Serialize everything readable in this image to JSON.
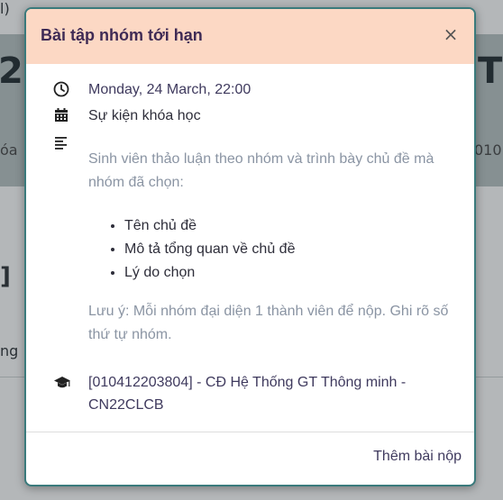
{
  "background": {
    "top_fragment": "l)",
    "big_heading_left": "2(",
    "big_heading_right": "T",
    "small_left": "óa",
    "small_right": "010",
    "bracket_text": "]",
    "lower_left": "ng"
  },
  "modal": {
    "title": "Bài tập nhóm tới hạn",
    "close_label": "×",
    "date": "Monday, 24 March, 22:00",
    "event_type": "Sự kiện khóa học",
    "description_intro": "Sinh viên thảo luận theo nhóm và  trình bày chủ đề mà nhóm đã chọn:",
    "bullets": [
      "Tên chủ đề",
      "Mô tả tổng quan về chủ đề",
      "Lý do chọn"
    ],
    "note": "Lưu ý: Mỗi nhóm đại diện 1 thành viên để nộp. Ghi rõ số thứ tự nhóm.",
    "course": "[010412203804] - CĐ Hệ Thống GT Thông minh - CN22CLCB",
    "footer_action": "Thêm bài nộp"
  },
  "icons": [
    "clock-icon",
    "calendar-icon",
    "description-icon",
    "graduation-cap-icon"
  ],
  "colors": {
    "header_bg": "#fcd8c4",
    "title": "#3f2b55",
    "border": "#3a7a7c",
    "muted_text": "#8a94a3"
  }
}
